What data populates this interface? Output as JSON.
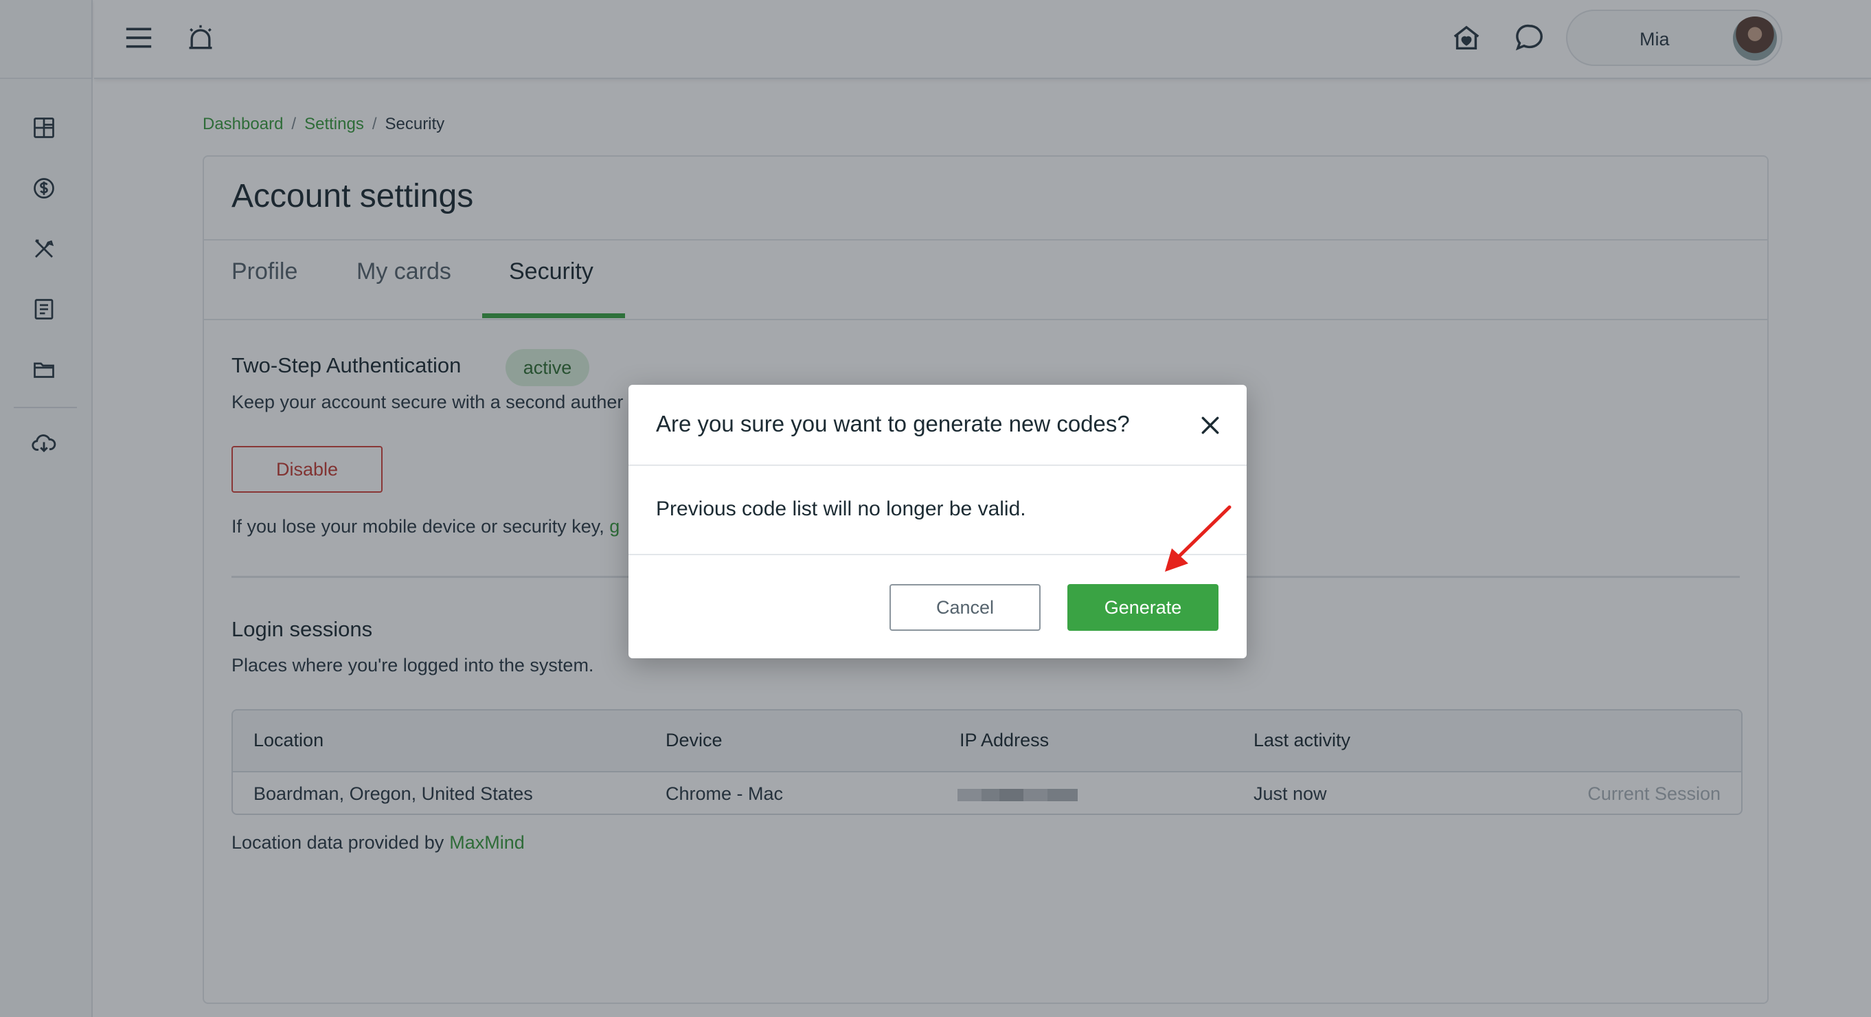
{
  "topbar": {
    "user_name": "Mia",
    "icons": [
      "menu-icon",
      "alarm-bell-icon",
      "home-heart-icon",
      "chat-bubble-icon",
      "help-icon"
    ]
  },
  "sidebar": {
    "icons": [
      "dashboard-grid-icon",
      "dollar-coin-icon",
      "tools-icon",
      "document-icon",
      "folder-icon",
      "cloud-download-icon"
    ]
  },
  "breadcrumb": {
    "items": [
      "Dashboard",
      "Settings",
      "Security"
    ],
    "separator": "/"
  },
  "page": {
    "title": "Account settings",
    "tabs": [
      {
        "label": "Profile",
        "active": false
      },
      {
        "label": "My cards",
        "active": false
      },
      {
        "label": "Security",
        "active": true
      }
    ]
  },
  "two_step": {
    "title": "Two-Step Authentication",
    "status": "active",
    "description": "Keep your account secure with a second auther",
    "disable_label": "Disable",
    "hint": "If you lose your mobile device or security key,",
    "hint_link": "g"
  },
  "sessions": {
    "title": "Login sessions",
    "description": "Places where you're logged into the system.",
    "columns": [
      "Location",
      "Device",
      "IP Address",
      "Last activity"
    ],
    "rows": [
      {
        "location": "Boardman, Oregon, United States",
        "device": "Chrome - Mac",
        "last_activity": "Just now",
        "note": "Current Session"
      }
    ],
    "footer_text": "Location data provided by",
    "footer_link": "MaxMind"
  },
  "modal": {
    "title": "Are you sure you want to generate new codes?",
    "body": "Previous code list will no longer be valid.",
    "cancel_label": "Cancel",
    "generate_label": "Generate"
  },
  "colors": {
    "accent": "#3aa344",
    "danger": "#d0443c",
    "badge_bg": "#d9eedb",
    "link": "#3a9b3f"
  }
}
